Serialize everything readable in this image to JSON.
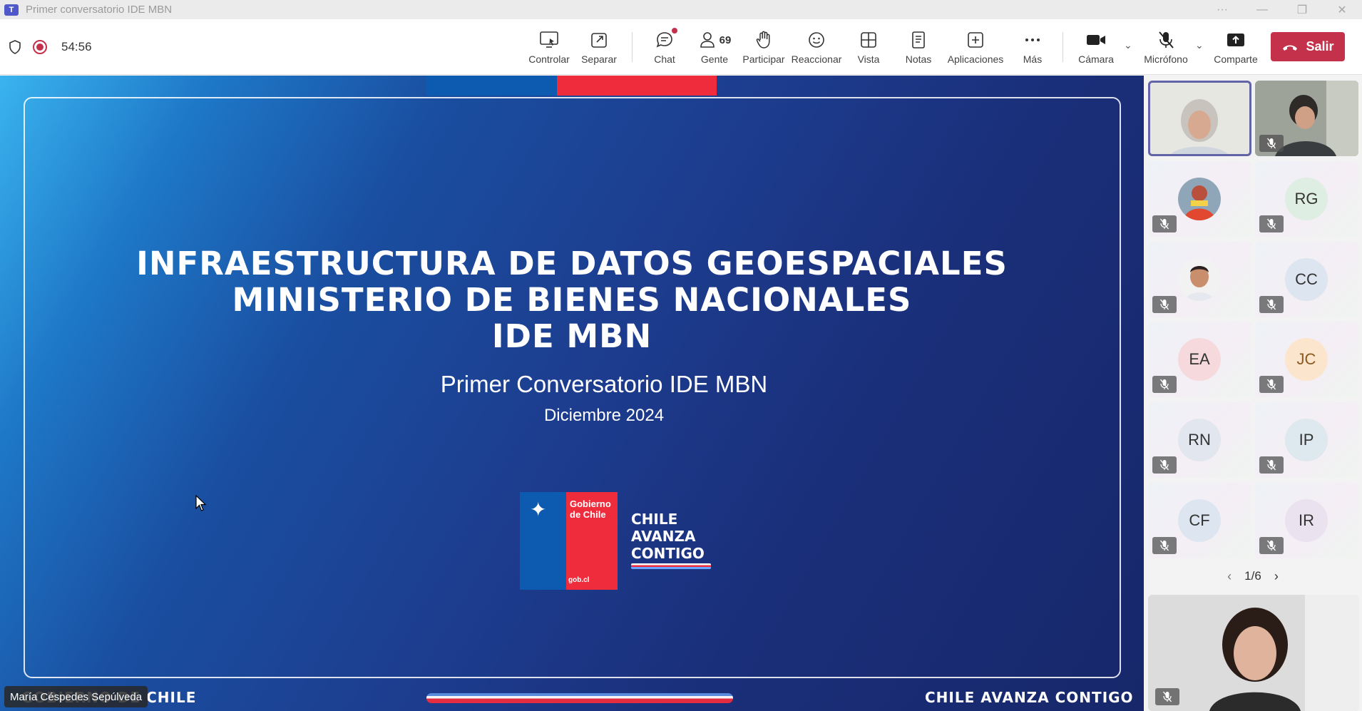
{
  "window": {
    "title": "Primer conversatorio IDE MBN",
    "controls": [
      "···",
      "—",
      "❐",
      "✕"
    ]
  },
  "toolbar": {
    "timer": "54:56",
    "buttons": [
      {
        "label": "Controlar",
        "icon": "share-screen-icon"
      },
      {
        "label": "Separar",
        "icon": "pop-out-icon"
      },
      {
        "label": "Chat",
        "icon": "chat-icon"
      },
      {
        "label": "Gente",
        "icon": "people-icon",
        "count": "69"
      },
      {
        "label": "Participar",
        "icon": "raise-hand-icon"
      },
      {
        "label": "Reaccionar",
        "icon": "smiley-icon"
      },
      {
        "label": "Vista",
        "icon": "grid-view-icon"
      },
      {
        "label": "Notas",
        "icon": "notes-icon"
      },
      {
        "label": "Aplicaciones",
        "icon": "add-apps-icon"
      },
      {
        "label": "Más",
        "icon": "more-icon"
      },
      {
        "label": "Cámara",
        "icon": "camera-icon"
      },
      {
        "label": "Micrófono",
        "icon": "mic-off-icon"
      },
      {
        "label": "Comparte",
        "icon": "share-icon"
      }
    ],
    "leave_label": "Salir"
  },
  "slide": {
    "title_line1": "INFRAESTRUCTURA DE DATOS GEOESPACIALES",
    "title_line2": "MINISTERIO DE BIENES NACIONALES",
    "title_line3": "IDE MBN",
    "subtitle": "Primer Conversatorio IDE MBN",
    "date": "Diciembre 2024",
    "logo_text_1": "Gobierno",
    "logo_text_2": "de Chile",
    "logo_url_text": "gob.cl",
    "slogan_1": "CHILE",
    "slogan_2": "AVANZA",
    "slogan_3": "CONTIGO",
    "footer_left": "GOBIERNO DE CHILE",
    "footer_right": "CHILE AVANZA CONTIGO",
    "colors": {
      "blue": "#0d5bb0",
      "red": "#ee2c3c"
    }
  },
  "presenter_label": "María Céspedes Sepúlveda",
  "participants": [
    {
      "initials": "RG",
      "color": "#dfeee3"
    },
    {
      "initials": "CC",
      "color": "#dde6f0"
    },
    {
      "initials": "EA",
      "color": "#f5d9dd"
    },
    {
      "initials": "JC",
      "color": "#fbe5cc"
    },
    {
      "initials": "RN",
      "color": "#e2e6ef"
    },
    {
      "initials": "IP",
      "color": "#dde9ee"
    },
    {
      "initials": "CF",
      "color": "#dde6f0"
    },
    {
      "initials": "IR",
      "color": "#ebe2f0"
    }
  ],
  "pager": {
    "text": "1/6"
  }
}
